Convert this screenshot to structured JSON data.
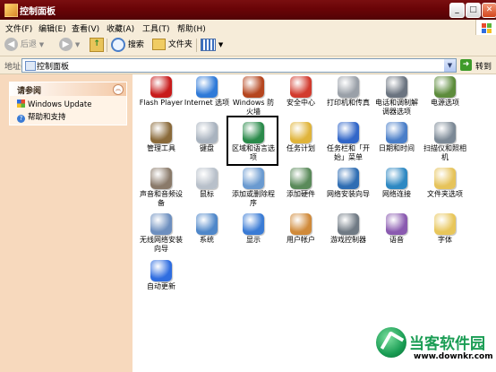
{
  "window": {
    "title": "控制面板"
  },
  "menu": [
    "文件(F)",
    "编辑(E)",
    "查看(V)",
    "收藏(A)",
    "工具(T)",
    "帮助(H)"
  ],
  "toolbar": {
    "back": "后退",
    "search": "搜索",
    "folders": "文件夹"
  },
  "address": {
    "label": "地址(D)",
    "value": "控制面板",
    "go": "转到"
  },
  "sidebar": {
    "panel_title": "请参阅",
    "links": [
      "Windows Update",
      "帮助和支持"
    ]
  },
  "items": [
    {
      "label": "Flash Player",
      "icon": "flash-icon"
    },
    {
      "label": "Internet 选项",
      "icon": "globe-icon"
    },
    {
      "label": "Windows 防火墙",
      "icon": "firewall-icon"
    },
    {
      "label": "安全中心",
      "icon": "shield-icon"
    },
    {
      "label": "打印机和传真",
      "icon": "printer-icon"
    },
    {
      "label": "电话和调制解调器选项",
      "icon": "phone-icon"
    },
    {
      "label": "电源选项",
      "icon": "power-icon"
    },
    {
      "label": "管理工具",
      "icon": "tools-icon"
    },
    {
      "label": "键盘",
      "icon": "keyboard-icon"
    },
    {
      "label": "区域和语言选项",
      "icon": "region-globe-icon"
    },
    {
      "label": "任务计划",
      "icon": "scheduler-icon"
    },
    {
      "label": "任务栏和「开始」菜单",
      "icon": "taskbar-icon"
    },
    {
      "label": "日期和时间",
      "icon": "clock-icon"
    },
    {
      "label": "扫描仪和照相机",
      "icon": "scanner-icon"
    },
    {
      "label": "声音和音频设备",
      "icon": "speaker-icon"
    },
    {
      "label": "鼠标",
      "icon": "mouse-icon"
    },
    {
      "label": "添加或删除程序",
      "icon": "addremove-icon"
    },
    {
      "label": "添加硬件",
      "icon": "hardware-icon"
    },
    {
      "label": "网络安装向导",
      "icon": "network-wizard-icon"
    },
    {
      "label": "网络连接",
      "icon": "network-icon"
    },
    {
      "label": "文件夹选项",
      "icon": "folder-options-icon"
    },
    {
      "label": "无线网络安装向导",
      "icon": "wireless-icon"
    },
    {
      "label": "系统",
      "icon": "system-icon"
    },
    {
      "label": "显示",
      "icon": "display-icon"
    },
    {
      "label": "用户帐户",
      "icon": "users-icon"
    },
    {
      "label": "游戏控制器",
      "icon": "gamepad-icon"
    },
    {
      "label": "语音",
      "icon": "speech-icon"
    },
    {
      "label": "字体",
      "icon": "fonts-icon"
    },
    {
      "label": "自动更新",
      "icon": "update-icon"
    }
  ],
  "watermark": {
    "brand": "当客软件园",
    "url": "www.downkr.com"
  },
  "colors": {
    "title_bar": "#6a0407",
    "sidebar": "#f7d9bd",
    "menu_bg": "#f6ecd9"
  }
}
